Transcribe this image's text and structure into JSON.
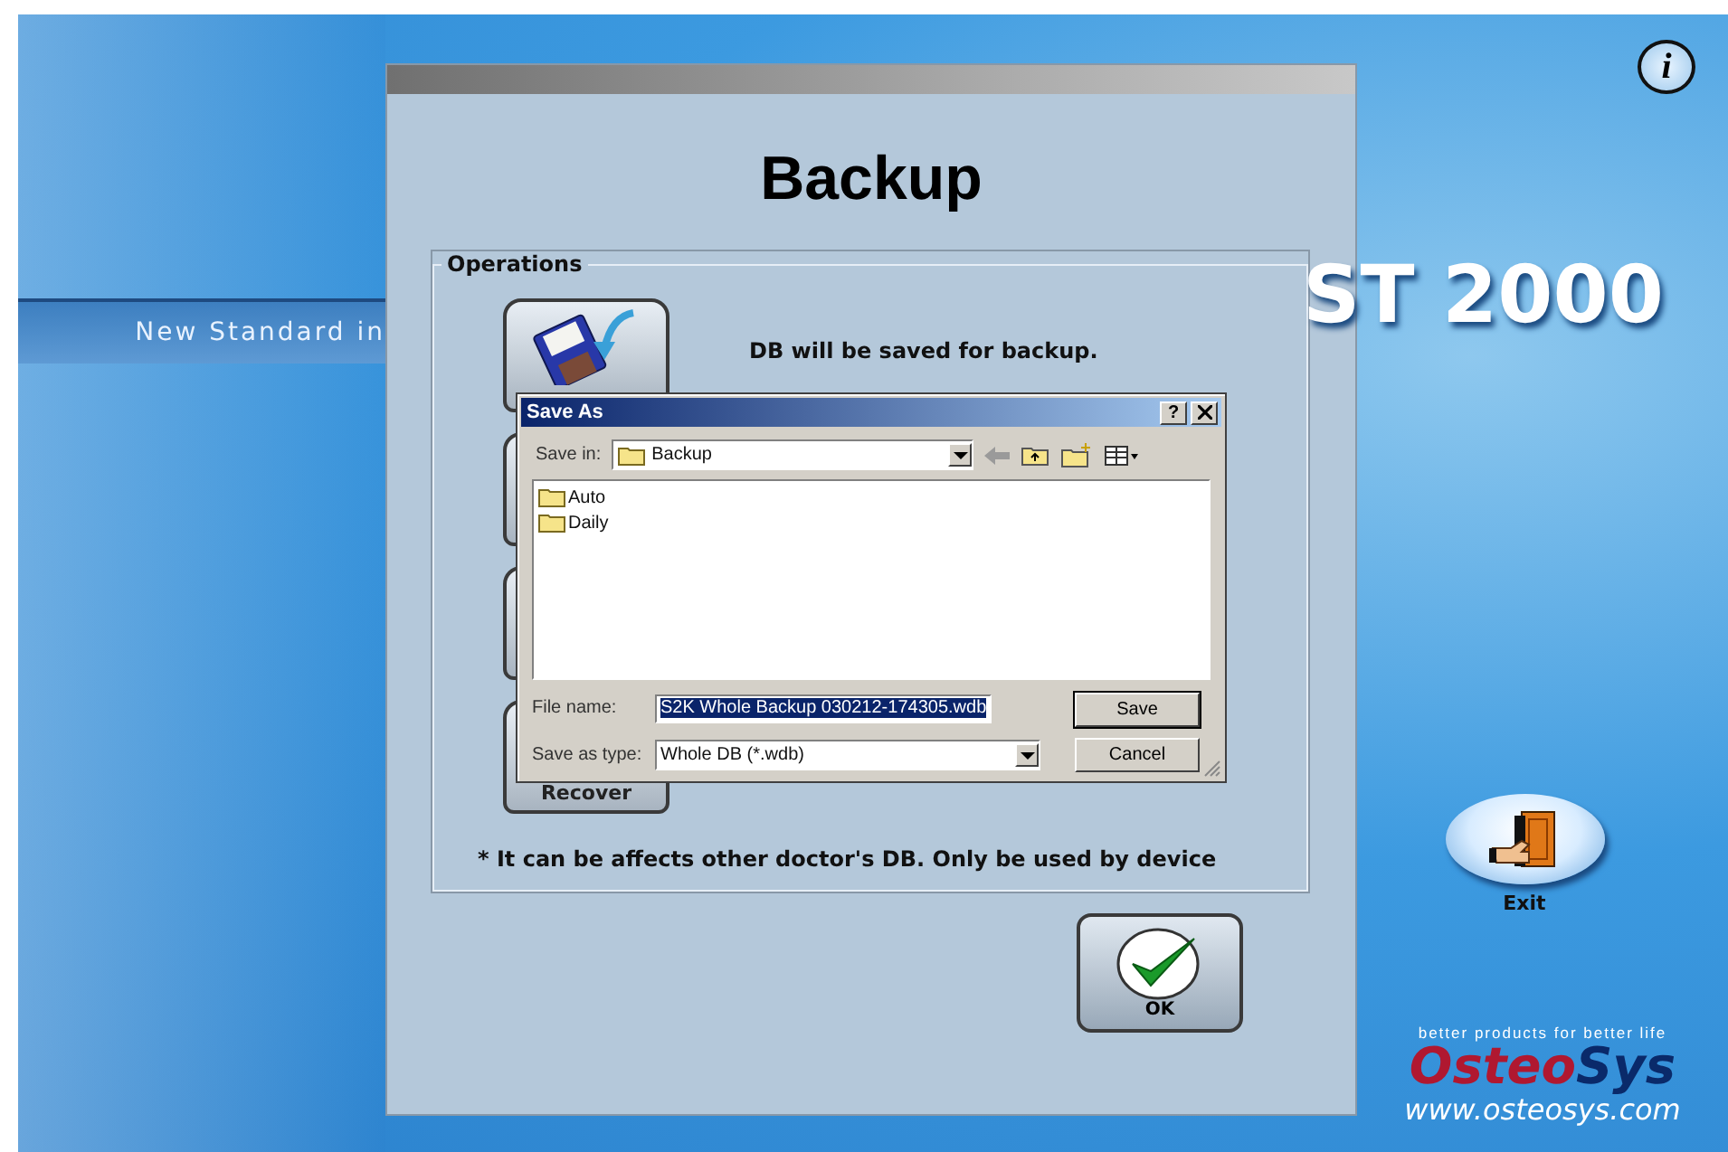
{
  "background": {
    "tagline": "New Standard in",
    "product_name": "ST 2000"
  },
  "info_button": {
    "label": "i"
  },
  "exit_button": {
    "label": "Exit"
  },
  "brand": {
    "slogan": "better products for better life",
    "logo_part_1": "Osteo",
    "logo_part_2": "Sys",
    "url": "www.osteosys.com"
  },
  "panel": {
    "title": "Backup",
    "group_label": "Operations",
    "operations": [
      {
        "kind": "backup"
      },
      {
        "kind": "blank"
      },
      {
        "kind": "blank"
      },
      {
        "kind": "recover",
        "label": "Recover"
      }
    ],
    "description": "DB will be saved for backup.",
    "note": "* It can be affects other doctor's DB. Only be used by device",
    "ok_button": {
      "label": "OK"
    }
  },
  "save_dialog": {
    "title": "Save As",
    "help_button": "?",
    "save_in_label": "Save in:",
    "save_in_value": "Backup",
    "files": [
      {
        "name": "Auto"
      },
      {
        "name": "Daily"
      }
    ],
    "file_name_label": "File name:",
    "file_name": "S2K Whole Backup 030212-174305.wdb",
    "file_name_highlighted": true,
    "save_as_type_label": "Save as type:",
    "save_as_type": "Whole DB (*.wdb)",
    "buttons": [
      "Save",
      "Cancel"
    ]
  }
}
